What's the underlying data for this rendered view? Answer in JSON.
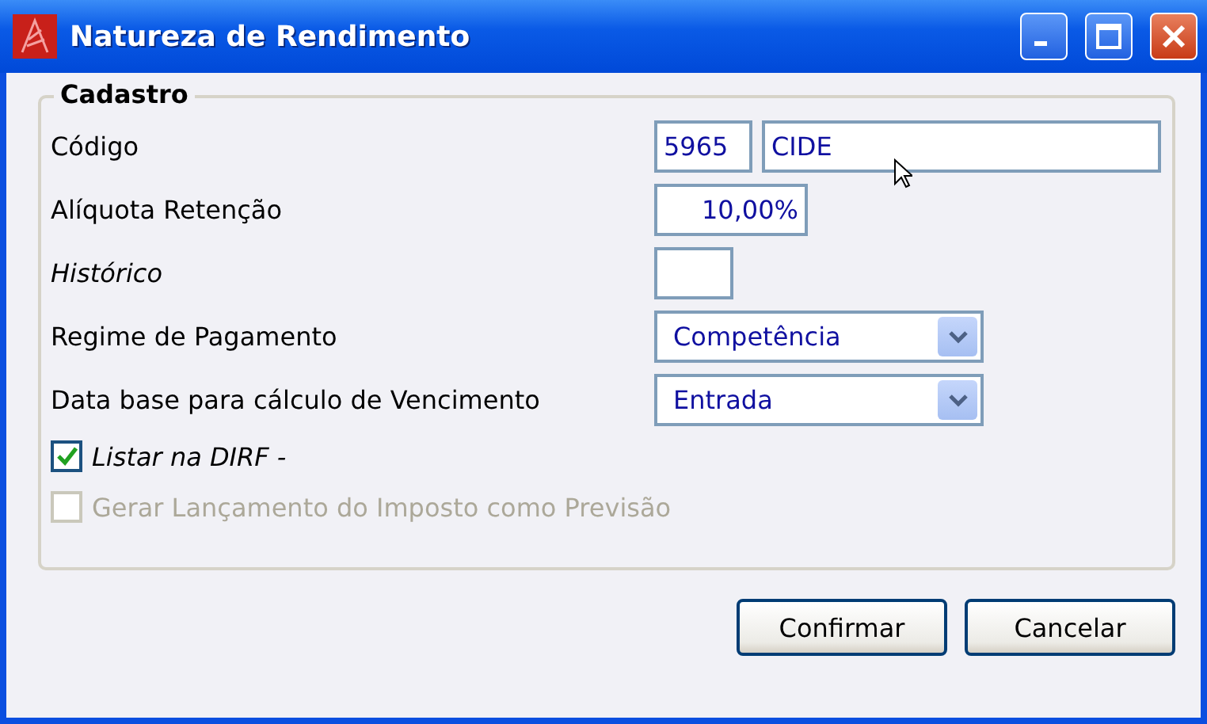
{
  "window": {
    "title": "Natureza de Rendimento"
  },
  "group": {
    "title": "Cadastro"
  },
  "fields": [
    {
      "kind": "code",
      "label": "Código",
      "italic": false,
      "code": "5965",
      "value": "CIDE"
    },
    {
      "kind": "number",
      "label": "Alíquota Retenção",
      "italic": false,
      "value": "10,00%"
    },
    {
      "kind": "small",
      "label": "Histórico",
      "italic": true
    },
    {
      "kind": "select",
      "label": "Regime de Pagamento",
      "italic": false,
      "value": "Competência"
    },
    {
      "kind": "select",
      "label": "Data base para cálculo de Vencimento",
      "italic": false,
      "value": "Entrada"
    }
  ],
  "checkboxes": [
    {
      "label": "Listar na DIRF -",
      "checked": true,
      "disabled": false,
      "italic": true
    },
    {
      "label": "Gerar Lançamento do Imposto como Previsão",
      "checked": false,
      "disabled": true,
      "italic": false
    }
  ],
  "buttons": [
    "Confirmar",
    "Cancelar"
  ]
}
